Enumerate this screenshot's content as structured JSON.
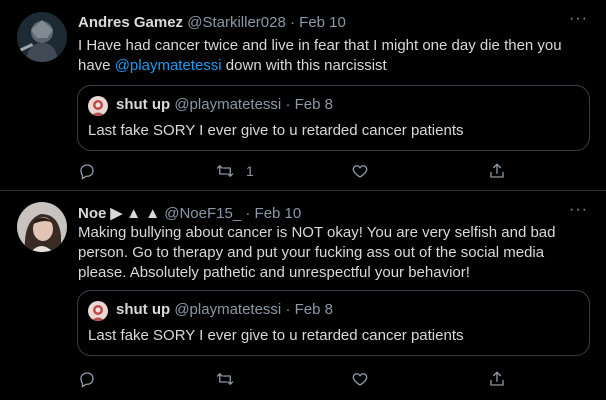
{
  "tweets": [
    {
      "author_name": "Andres Gamez",
      "handle": "@Starkiller028",
      "sep": "·",
      "date": "Feb 10",
      "more": "···",
      "text_before": "I Have had cancer twice and live in fear that I might one day die then you have ",
      "mention": "@playmatetessi",
      "text_after": " down with this narcissist",
      "quote": {
        "author_name": "shut up",
        "handle": "@playmatetessi",
        "sep": "·",
        "date": "Feb 8",
        "text": "Last fake SORY I ever give to u retarded cancer patients"
      },
      "actions": {
        "reply_count": "",
        "retweet_count": "1",
        "like_count": ""
      }
    },
    {
      "author_name": "Noe ▶ ▲ ▲",
      "handle": "@NoeF15_",
      "sep": "·",
      "date": "Feb 10",
      "more": "···",
      "text": "Making bullying about cancer is NOT okay! You are very selfish and bad person. Go to therapy and put your fucking ass out of the social media please. Absolutely pathetic and unrespectful your behavior!",
      "quote": {
        "author_name": "shut up",
        "handle": "@playmatetessi",
        "sep": "·",
        "date": "Feb 8",
        "text": "Last fake SORY I ever give to u retarded cancer patients"
      },
      "actions": {
        "reply_count": "",
        "retweet_count": "",
        "like_count": ""
      }
    }
  ],
  "colors": {
    "background": "#000000",
    "text": "#d9d9d9",
    "muted": "#8b98a5",
    "link": "#1d9bf0",
    "border": "#3a3f44"
  },
  "icons": [
    "reply-icon",
    "retweet-icon",
    "like-icon",
    "share-icon",
    "more-icon"
  ]
}
